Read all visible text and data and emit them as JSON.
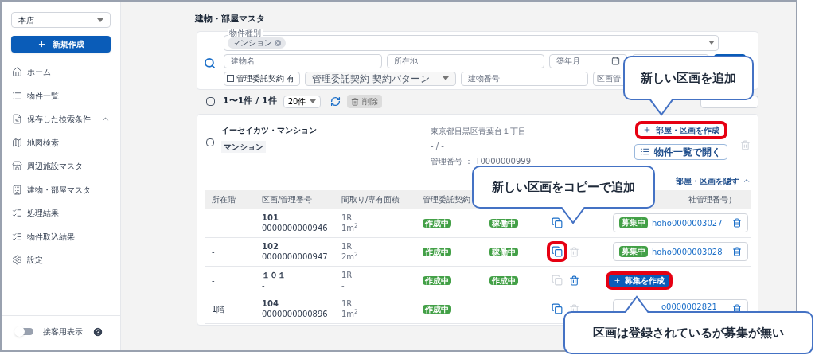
{
  "sidebar": {
    "store_select": {
      "value": "本店"
    },
    "new_button": {
      "label": "新規作成"
    },
    "items": [
      {
        "label": "ホーム"
      },
      {
        "label": "物件一覧"
      },
      {
        "label": "保存した検索条件",
        "expanded": true
      },
      {
        "label": "地図検索"
      },
      {
        "label": "周辺施設マスタ"
      },
      {
        "label": "建物・部屋マスタ"
      },
      {
        "label": "処理結果"
      },
      {
        "label": "物件取込結果"
      },
      {
        "label": "設定"
      }
    ],
    "footer": {
      "label": "接客用表示",
      "on": false
    }
  },
  "page_title": "建物・部屋マスタ",
  "search": {
    "type_field": {
      "label": "物件種別",
      "chips": [
        "マンション"
      ]
    },
    "building_name": {
      "placeholder": "建物名"
    },
    "location": {
      "placeholder": "所在地"
    },
    "built_month": {
      "placeholder": "築年月"
    },
    "contract_check": {
      "label": "管理委託契約 有",
      "checked": false
    },
    "contract_pattern": {
      "placeholder": "管理委託契約 契約パターン"
    },
    "building_number": {
      "placeholder": "建物番号"
    },
    "unit_number": {
      "placeholder": "区画管"
    }
  },
  "toolbar": {
    "checked": false,
    "count": "1〜1件 / 1件",
    "page_size": "20件",
    "delete_label": "削除"
  },
  "building": {
    "checked": false,
    "name": "イーセイカツ・マンション",
    "type_tag": "マンション",
    "address": "東京都目黒区青葉台１丁目",
    "access": "- / -",
    "management_number": "管理番号 ： T0000000999",
    "create_button": {
      "label": "部屋・区画を作成",
      "highlighted": true
    },
    "open_button": {
      "label": "物件一覧で開く"
    },
    "toggle_units": {
      "label": "部屋・区画を隠す",
      "expanded": true
    }
  },
  "table": {
    "columns": [
      "所在階",
      "区画/管理番号",
      "間取り/専有面積",
      "管理委託契約",
      "社管理番号）"
    ],
    "rows": [
      {
        "floor": "-",
        "unit": "101",
        "code": "0000000000946",
        "layout": "1R",
        "area": "1m$^{2}$",
        "contract": "作成中",
        "operation": {
          "kind": "badge",
          "text": "稼働中"
        },
        "copy_enabled": true,
        "copy_highlighted": false,
        "recruit": {
          "kind": "listing",
          "badge": "募集中",
          "link": "hoho0000003027"
        }
      },
      {
        "floor": "-",
        "unit": "102",
        "code": "0000000000947",
        "layout": "1R",
        "area": "2m$^{2}$",
        "contract": "作成中",
        "operation": {
          "kind": "badge",
          "text": "稼働中"
        },
        "copy_enabled": true,
        "copy_highlighted": true,
        "trash_enabled": false,
        "recruit": {
          "kind": "listing",
          "badge": "募集中",
          "link": "hoho0000003028"
        }
      },
      {
        "floor": "-",
        "unit": "１０１",
        "code": "-",
        "layout": "1R",
        "area": "-",
        "contract": "作成中",
        "operation": {
          "kind": "badge",
          "text": "作成中"
        },
        "copy_enabled": false,
        "copy_highlighted": false,
        "trash_enabled": true,
        "recruit": {
          "kind": "create",
          "label": "募集を作成",
          "highlighted": true
        }
      },
      {
        "floor": "1階",
        "unit": "104",
        "code": "0000000000896",
        "layout": "1R",
        "area": "1m$^{2}$",
        "contract": "作成中",
        "operation": {
          "kind": "text",
          "text": "-"
        },
        "copy_enabled": true,
        "copy_highlighted": false,
        "trash_enabled": false,
        "recruit": {
          "kind": "partial",
          "link": "o0000002821"
        }
      }
    ]
  },
  "callouts": [
    {
      "text": "新しい区画を追加",
      "kind": "down"
    },
    {
      "text": "新しい区画をコピーで追加",
      "kind": "down"
    },
    {
      "text": "区画は登録されているが募集が無い",
      "kind": "up"
    }
  ]
}
